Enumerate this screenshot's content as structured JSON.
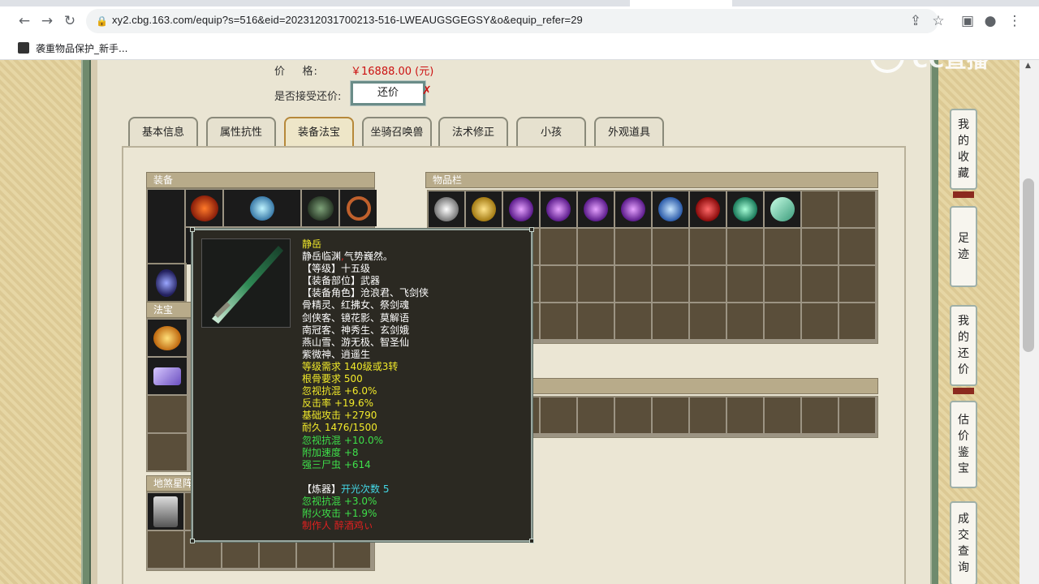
{
  "browser": {
    "url": "xy2.cbg.163.com/equip?s=516&eid=202312031700213-516-LWEAUGSGEGSY&o&equip_refer=29",
    "bookmark": "袭重物品保护_新手..."
  },
  "watermark": "CC直播",
  "price": {
    "label": "价    格:",
    "value": "￥16888.00 (元)"
  },
  "counter_offer": {
    "label": "是否接受还价:",
    "button": "还价",
    "mark": "✗"
  },
  "tabs": [
    {
      "label": "基本信息"
    },
    {
      "label": "属性抗性"
    },
    {
      "label": "装备法宝"
    },
    {
      "label": "坐骑召唤兽"
    },
    {
      "label": "法术修正"
    },
    {
      "label": "小孩"
    },
    {
      "label": "外观道具"
    }
  ],
  "sections": {
    "equipment": "装备",
    "fabao": "法宝",
    "dishaxing": "地煞星阵",
    "inventory": "物品栏"
  },
  "tooltip": {
    "name": "静岳",
    "desc_a": "静岳临渊",
    "desc_comma": ",",
    "desc_b": "气势巍然。",
    "level": "【等级】十五级",
    "slot": "【装备部位】武器",
    "roles": [
      "【装备角色】沧浪君、飞剑侠",
      "骨精灵、红拂女、祭剑魂",
      "剑侠客、镜花影、莫解语",
      "南冠客、神秀生、玄剑娥",
      "燕山雪、游无极、智圣仙",
      "紫微神、逍遥生"
    ],
    "req_level": "等级需求 140级或3转",
    "req_gengu": "根骨要求 500",
    "stat1": "忽视抗混 +6.0%",
    "stat2": "反击率 +19.6%",
    "stat3": "基础攻击 +2790",
    "durability": "耐久 1476/1500",
    "green1": "忽视抗混 +10.0%",
    "green2": "附加速度 +8",
    "green3": "强三尸虫 +614",
    "refine_tag": "【炼器】",
    "refine_label": "开光次数",
    "refine_count": "5",
    "refine1": "忽视抗混 +3.0%",
    "refine2": "附火攻击 +1.9%",
    "maker": "制作人 醉酒鸡ぃ"
  },
  "side_buttons": [
    {
      "chars": [
        "我",
        "的",
        "收",
        "藏"
      ]
    },
    {
      "chars": [
        "足",
        "迹"
      ]
    },
    {
      "chars": [
        "我",
        "的",
        "还",
        "价"
      ]
    },
    {
      "chars": [
        "估",
        "价",
        "鉴",
        "宝"
      ]
    },
    {
      "chars": [
        "成",
        "交",
        "查",
        "询"
      ]
    }
  ],
  "colors": {
    "price_red": "#cc1111",
    "tooltip_yellow": "#f2ea2a",
    "tooltip_green": "#3ee04a",
    "tooltip_cyan": "#43d7e6",
    "tooltip_red": "#e02020"
  }
}
